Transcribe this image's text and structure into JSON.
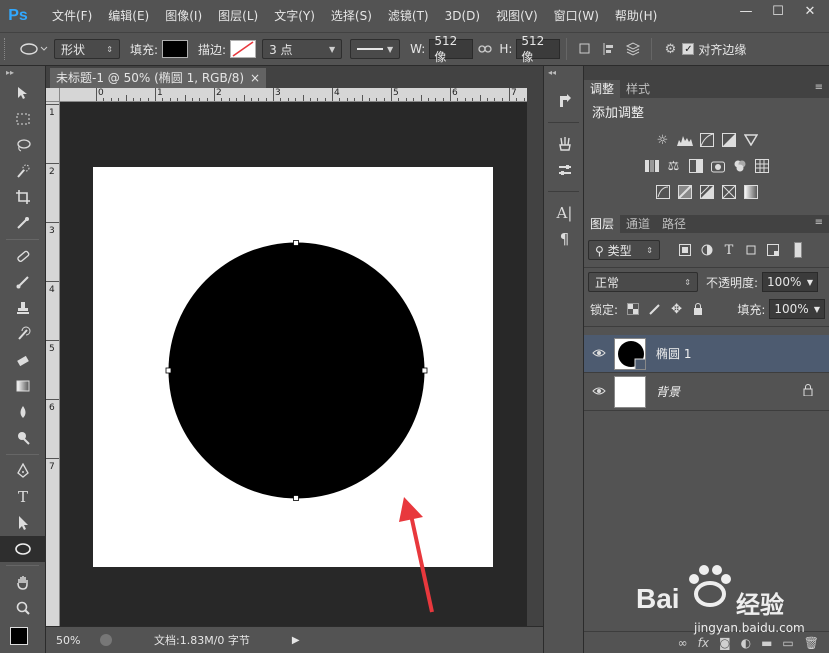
{
  "app": {
    "logo": "Ps"
  },
  "menu": [
    "文件(F)",
    "编辑(E)",
    "图像(I)",
    "图层(L)",
    "文字(Y)",
    "选择(S)",
    "滤镜(T)",
    "3D(D)",
    "视图(V)",
    "窗口(W)",
    "帮助(H)"
  ],
  "window_controls": {
    "minimize": "—",
    "restore": "☐",
    "close": "✕"
  },
  "options": {
    "mode": "形状",
    "fill_label": "填充:",
    "stroke_label": "描边:",
    "stroke_size": "3 点",
    "w_label": "W:",
    "w_value": "512 像",
    "h_label": "H:",
    "h_value": "512 像",
    "align_edges": "对齐边缘"
  },
  "document": {
    "tab_title": "未标题-1 @ 50% (椭圆 1, RGB/8) *",
    "tab_close": "×",
    "ruler_top": [
      "0",
      "1",
      "2",
      "3",
      "4",
      "5",
      "6",
      "7"
    ],
    "ruler_left": [
      "1",
      "2",
      "3",
      "4",
      "5",
      "6",
      "7"
    ],
    "zoom": "50%",
    "doc_info": "文档:1.83M/0 字节"
  },
  "adjustments": {
    "tab_active": "调整",
    "tab_other": "样式",
    "title": "添加调整"
  },
  "layers_panel": {
    "tabs": [
      "图层",
      "通道",
      "路径"
    ],
    "filter_kind": "类型",
    "blend_mode": "正常",
    "opacity_label": "不透明度:",
    "opacity_value": "100%",
    "lock_label": "锁定:",
    "fill_label": "填充:",
    "fill_value": "100%",
    "layers": [
      {
        "name": "椭圆 1",
        "selected": true
      },
      {
        "name": "背景",
        "selected": false
      }
    ]
  },
  "watermark": {
    "brand": "Bai",
    "brand2": "经验",
    "url": "jingyan.baidu.com"
  },
  "colors": {
    "accent_blue": "#31a8ff",
    "annotation_red": "#e8383d",
    "selected_layer": "#4d5b70"
  }
}
